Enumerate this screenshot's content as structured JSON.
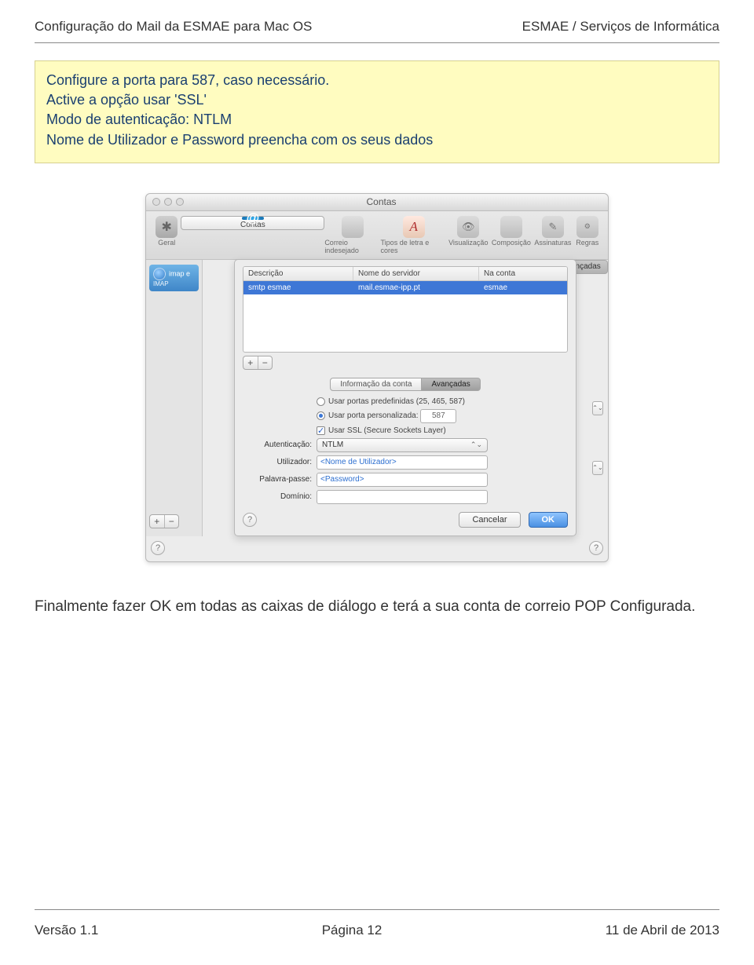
{
  "header": {
    "left": "Configuração do Mail da ESMAE para Mac OS",
    "right": "ESMAE / Serviços de Informática"
  },
  "note": {
    "l1": "Configure a porta para 587, caso necessário.",
    "l2": "Active a opção usar 'SSL'",
    "l3": "Modo de autenticação: NTLM",
    "l4": "Nome de Utilizador e Password preencha com os seus dados"
  },
  "mac": {
    "title": "Contas",
    "toolbar": [
      "Geral",
      "Contas",
      "Correio indesejado",
      "Tipos de letra e cores",
      "Visualização",
      "Composição",
      "Assinaturas",
      "Regras"
    ],
    "sidebar": {
      "accountLine1": "imap e",
      "accountLine2": "IMAP"
    },
    "cutTab": "ançadas",
    "list": {
      "headers": [
        "Descrição",
        "Nome do servidor",
        "Na conta"
      ],
      "row": [
        "smtp esmae",
        "mail.esmae-ipp.pt",
        "esmae"
      ]
    },
    "tabs": [
      "Informação da conta",
      "Avançadas"
    ],
    "portsPreset": "Usar portas predefinidas (25, 465, 587)",
    "portCustom": "Usar porta personalizada:",
    "portValue": "587",
    "ssl": "Usar SSL (Secure Sockets Layer)",
    "authLabel": "Autenticação:",
    "authValue": "NTLM",
    "userLabel": "Utilizador:",
    "userValue": "<Nome de Utilizador>",
    "passLabel": "Palavra-passe:",
    "passValue": "<Password>",
    "domainLabel": "Domínio:",
    "cancel": "Cancelar",
    "ok": "OK",
    "plus": "+",
    "minus": "−",
    "help": "?"
  },
  "trailing": "Finalmente fazer OK em todas as caixas de diálogo e terá a sua conta de correio POP Configurada.",
  "footer": {
    "left": "Versão 1.1",
    "center": "Página 12",
    "right": "11 de Abril de 2013"
  }
}
